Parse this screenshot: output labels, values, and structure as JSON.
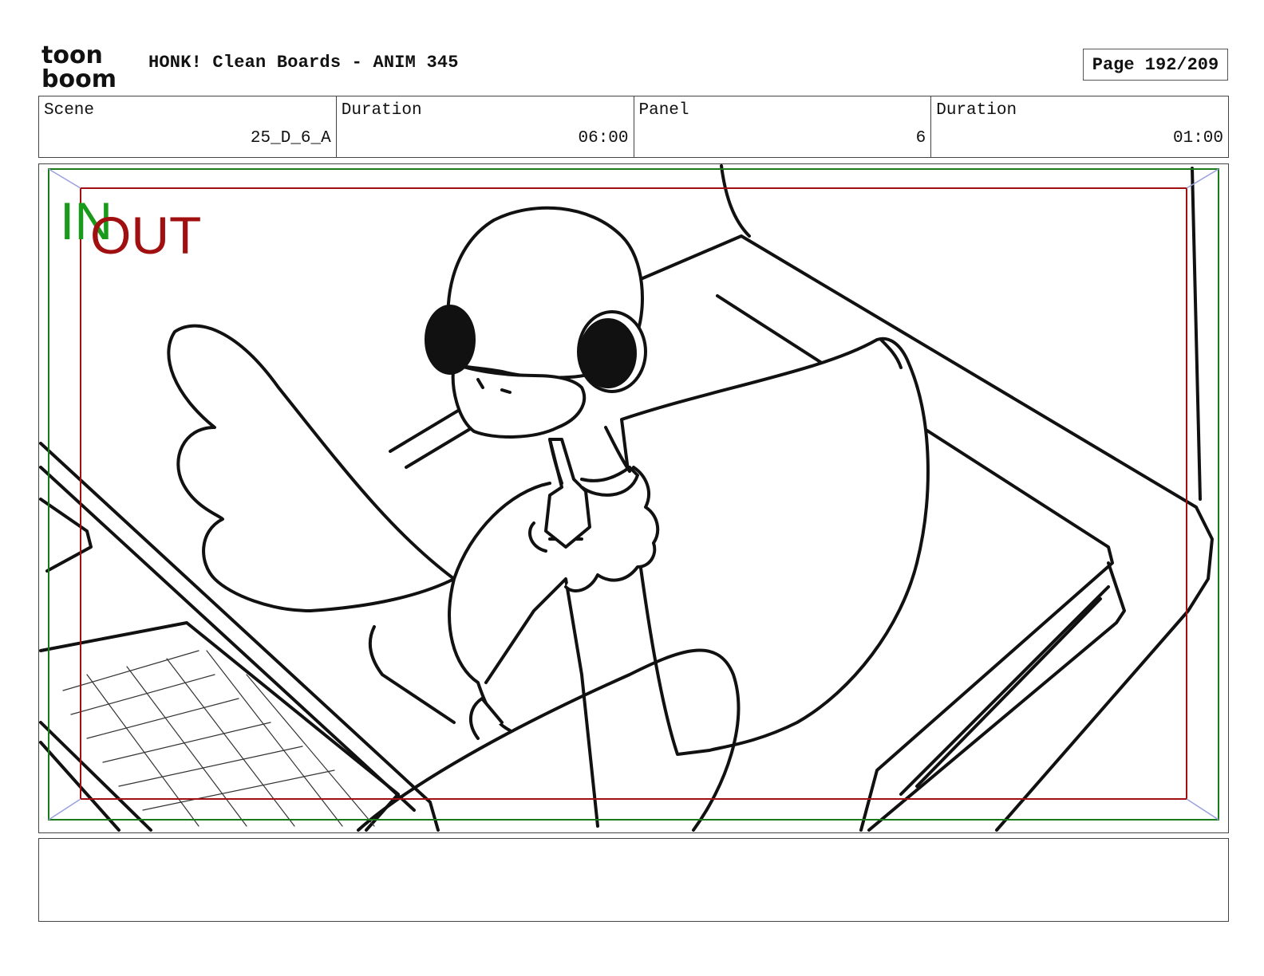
{
  "header": {
    "logo_line1": "toon",
    "logo_line2": "boom",
    "title": "HONK! Clean Boards - ANIM 345",
    "page": "Page 192/209"
  },
  "info": {
    "scene_label": "Scene",
    "scene_value": "25_D_6_A",
    "scene_duration_label": "Duration",
    "scene_duration_value": "06:00",
    "panel_label": "Panel",
    "panel_value": "6",
    "panel_duration_label": "Duration",
    "panel_duration_value": "01:00"
  },
  "frame": {
    "in_label": "IN",
    "out_label": "OUT",
    "in_color": "#1a9a1a",
    "out_color": "#a01010"
  },
  "notes": {
    "text": ""
  }
}
